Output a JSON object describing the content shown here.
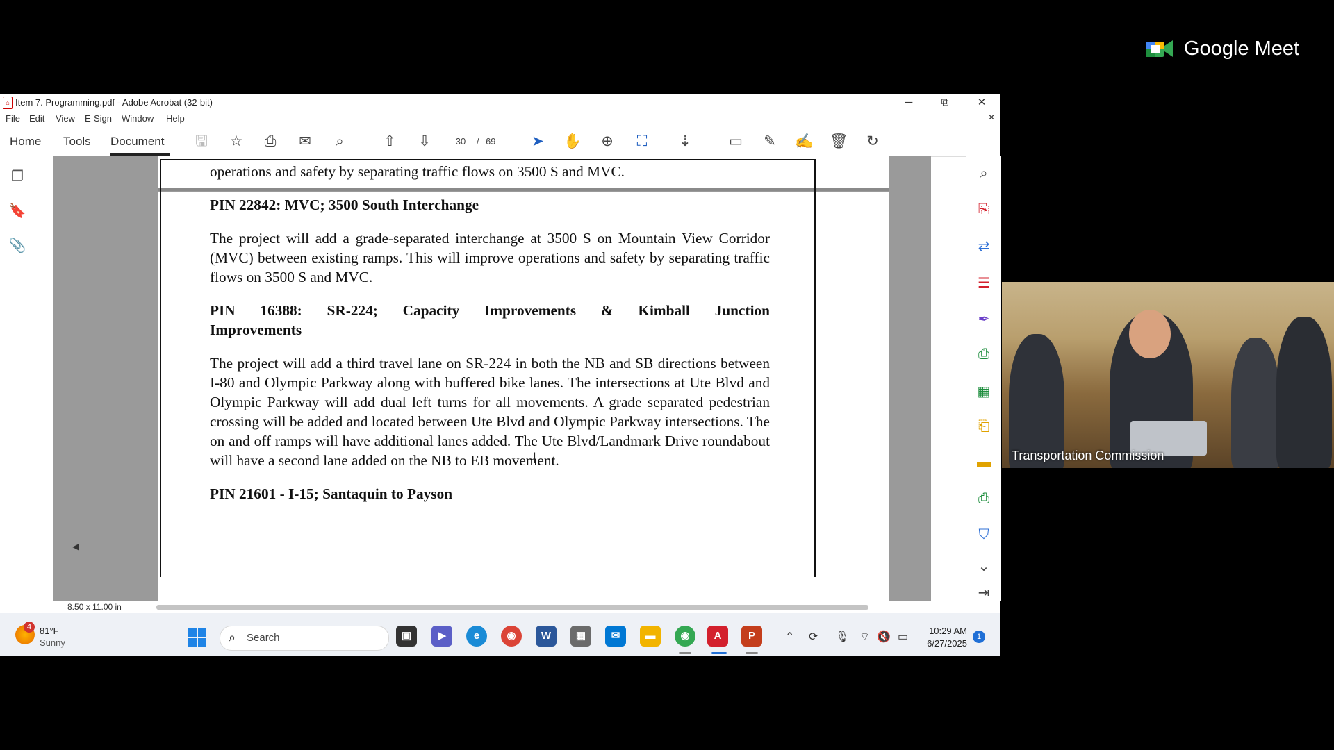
{
  "meet": {
    "brand": "Google Meet",
    "participant_label": "Transportation Commission"
  },
  "window": {
    "title": "Item 7. Programming.pdf - Adobe Acrobat (32-bit)",
    "minimize": "─",
    "maximize": "⧉",
    "close": "✕",
    "doc_close": "✕"
  },
  "menu": [
    "File",
    "Edit",
    "View",
    "E-Sign",
    "Window",
    "Help"
  ],
  "tabs": {
    "home": "Home",
    "tools": "Tools",
    "document": "Document"
  },
  "toolbar": {
    "page_current": "30",
    "page_separator": "/",
    "page_total": "69"
  },
  "document": {
    "line_top": "operations and safety by separating traffic flows on 3500 S and MVC.",
    "heading_1": "PIN 22842: MVC; 3500 South Interchange",
    "para_1": "The project will add a grade-separated interchange at 3500 S on Mountain View Corridor (MVC) between existing ramps. This will improve operations and safety by separating traffic flows on 3500 S and MVC.",
    "heading_2_line1": "PIN 16388: SR-224; Capacity Improvements & Kimball Junction",
    "heading_2_line2": "Improvements",
    "para_2": "The project will add a third travel lane on SR-224 in both the NB and SB directions between I-80 and Olympic Parkway along with buffered bike lanes.  The intersections at Ute Blvd and Olympic Parkway will add dual left turns for all movements. A grade separated pedestrian crossing will be added and located between Ute Blvd and Olympic Parkway intersections.  The on and off ramps will have additional lanes added.  The Ute Blvd/Landmark Drive roundabout will have a second lane added on the NB to EB movement.",
    "heading_3": "PIN 21601 - I-15; Santaquin to Payson"
  },
  "statusbar": {
    "page_size": "8.50 x 11.00 in"
  },
  "taskbar": {
    "weather_badge": "4",
    "weather_temp": "81°F",
    "weather_condition": "Sunny",
    "search_placeholder": "Search",
    "time": "10:29 AM",
    "date": "6/27/2025",
    "notification_count": "1"
  },
  "colors": {
    "acrobat_red": "#d3202d",
    "windows_blue": "#1f84e6"
  }
}
